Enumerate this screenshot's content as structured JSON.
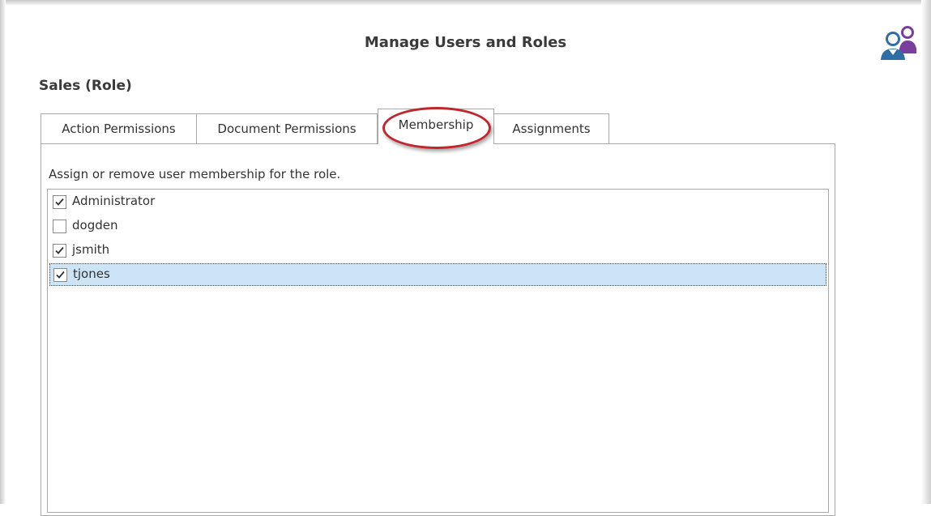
{
  "header": {
    "title": "Manage Users and Roles",
    "icon": "users-icon"
  },
  "role": {
    "title": "Sales (Role)"
  },
  "tabs": [
    {
      "label": "Action Permissions",
      "active": false
    },
    {
      "label": "Document Permissions",
      "active": false
    },
    {
      "label": "Membership",
      "active": true
    },
    {
      "label": "Assignments",
      "active": false
    }
  ],
  "membership": {
    "description": "Assign or remove user membership for the role.",
    "members": [
      {
        "name": "Administrator",
        "checked": true,
        "selected": false
      },
      {
        "name": "dogden",
        "checked": false,
        "selected": false
      },
      {
        "name": "jsmith",
        "checked": true,
        "selected": false
      },
      {
        "name": "tjones",
        "checked": true,
        "selected": true
      }
    ]
  },
  "colors": {
    "highlight_oval": "#c0272d",
    "selected_row": "#cde4f7",
    "icon_blue": "#2f6ea7",
    "icon_purple": "#7a3e9d"
  }
}
